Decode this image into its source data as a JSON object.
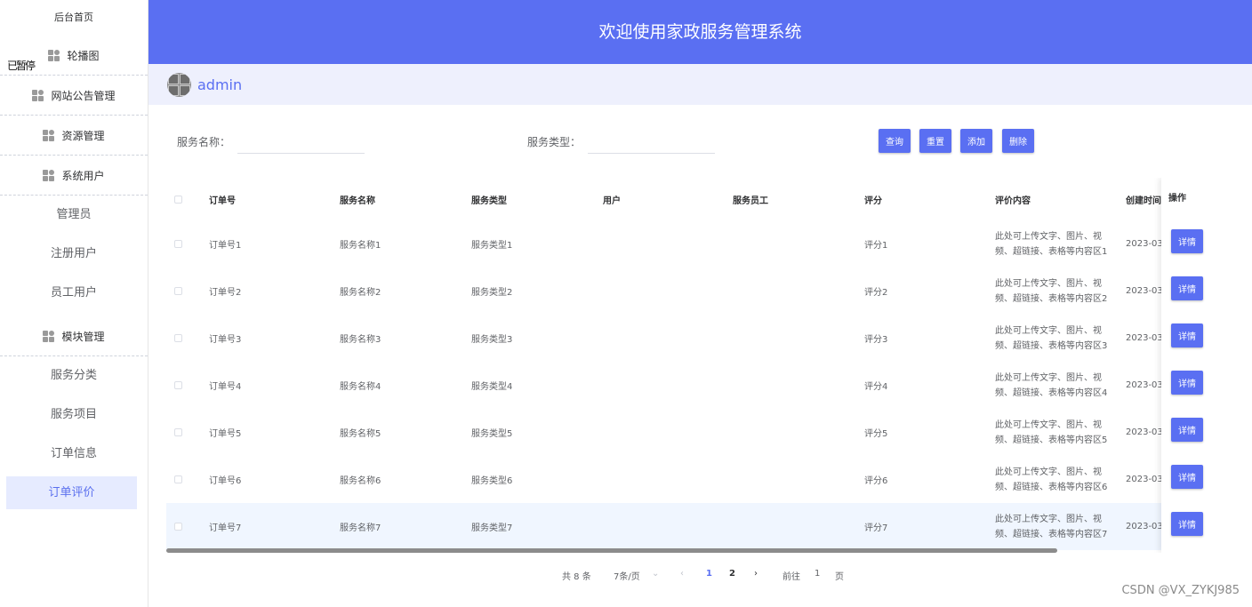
{
  "header": {
    "title": "欢迎使用家政服务管理系统",
    "username": "admin"
  },
  "sidebar": {
    "home": "后台首页",
    "overlay_text": "已暂停",
    "groups": [
      "轮播图",
      "网站公告管理",
      "资源管理",
      "系统用户",
      "模块管理"
    ],
    "user_items": [
      "管理员",
      "注册用户",
      "员工用户"
    ],
    "module_items": [
      "服务分类",
      "服务项目",
      "订单信息",
      "订单评价"
    ]
  },
  "search": {
    "service_name_label": "服务名称：",
    "service_type_label": "服务类型：",
    "query": "查询",
    "reset": "重置",
    "add": "添加",
    "delete": "删除"
  },
  "table": {
    "headers": [
      "订单号",
      "服务名称",
      "服务类型",
      "用户",
      "服务员工",
      "评分",
      "评价内容",
      "创建时间",
      "操作"
    ],
    "detail_label": "详情",
    "rows": [
      {
        "order": "订单号1",
        "name": "服务名称1",
        "type": "服务类型1",
        "user": "",
        "staff": "",
        "score": "评分1",
        "content1": "此处可上传文字、图片、视",
        "content2": "频、超链接、表格等内容区1",
        "created": "2023-03-"
      },
      {
        "order": "订单号2",
        "name": "服务名称2",
        "type": "服务类型2",
        "user": "",
        "staff": "",
        "score": "评分2",
        "content1": "此处可上传文字、图片、视",
        "content2": "频、超链接、表格等内容区2",
        "created": "2023-03-"
      },
      {
        "order": "订单号3",
        "name": "服务名称3",
        "type": "服务类型3",
        "user": "",
        "staff": "",
        "score": "评分3",
        "content1": "此处可上传文字、图片、视",
        "content2": "频、超链接、表格等内容区3",
        "created": "2023-03-"
      },
      {
        "order": "订单号4",
        "name": "服务名称4",
        "type": "服务类型4",
        "user": "",
        "staff": "",
        "score": "评分4",
        "content1": "此处可上传文字、图片、视",
        "content2": "频、超链接、表格等内容区4",
        "created": "2023-03-"
      },
      {
        "order": "订单号5",
        "name": "服务名称5",
        "type": "服务类型5",
        "user": "",
        "staff": "",
        "score": "评分5",
        "content1": "此处可上传文字、图片、视",
        "content2": "频、超链接、表格等内容区5",
        "created": "2023-03-"
      },
      {
        "order": "订单号6",
        "name": "服务名称6",
        "type": "服务类型6",
        "user": "",
        "staff": "",
        "score": "评分6",
        "content1": "此处可上传文字、图片、视",
        "content2": "频、超链接、表格等内容区6",
        "created": "2023-03-"
      },
      {
        "order": "订单号7",
        "name": "服务名称7",
        "type": "服务类型7",
        "user": "",
        "staff": "",
        "score": "评分7",
        "content1": "此处可上传文字、图片、视",
        "content2": "频、超链接、表格等内容区7",
        "created": "2023-03-"
      }
    ]
  },
  "pagination": {
    "total": "共 8 条",
    "page_size": "7条/页",
    "pages": [
      "1",
      "2"
    ],
    "current": "1",
    "goto_label": "前往",
    "goto_value": "1",
    "page_unit": "页"
  },
  "watermark": "CSDN @VX_ZYKJ985",
  "colors": {
    "primary": "#5a6ff2",
    "userbar": "#eef0fd",
    "active_item": "#e6ebff"
  }
}
